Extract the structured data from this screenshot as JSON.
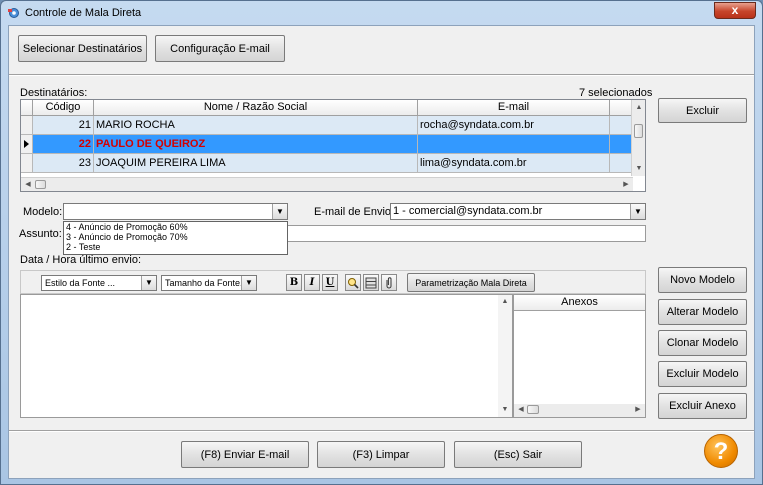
{
  "window": {
    "title": "Controle de Mala Direta",
    "close_label": "x"
  },
  "top_buttons": {
    "select_recipients": "Selecionar Destinatários",
    "email_config": "Configuração E-mail"
  },
  "recipients": {
    "label": "Destinatários:",
    "selected_count": "7 selecionados",
    "columns": [
      "Código",
      "Nome / Razão Social",
      "E-mail"
    ],
    "rows": [
      {
        "code": "21",
        "name": "MARIO ROCHA",
        "email": "rocha@syndata.com.br"
      },
      {
        "code": "22",
        "name": "PAULO DE QUEIROZ",
        "email": ""
      },
      {
        "code": "23",
        "name": "JOAQUIM PEREIRA LIMA",
        "email": "lima@syndata.com.br"
      }
    ],
    "delete_button": "Excluir"
  },
  "form": {
    "model_label": "Modelo:",
    "model_value": "",
    "model_options": [
      "4 - Anúncio de Promoção 60%",
      "3 - Anúncio de Promoção 70%",
      "2 - Teste"
    ],
    "email_from_label": "E-mail de Envio:",
    "email_from_value": "1 - comercial@syndata.com.br",
    "subject_label": "Assunto:",
    "subject_value": "",
    "last_sent_label": "Data / Hora último envio:"
  },
  "editor": {
    "font_style": "Estilo da Fonte ...",
    "font_size": "Tamanho da Fonte...",
    "bold": "B",
    "italic": "I",
    "underline": "U",
    "param_button": "Parametrização Mala Direta",
    "attachments_header": "Anexos"
  },
  "side_buttons": {
    "new_model": "Novo Modelo",
    "edit_model": "Alterar Modelo",
    "clone_model": "Clonar Modelo",
    "delete_model": "Excluir Modelo",
    "delete_attachment": "Excluir Anexo"
  },
  "bottom_buttons": {
    "send": "(F8) Enviar E-mail",
    "clear": "(F3) Limpar",
    "exit": "(Esc) Sair"
  },
  "help": {
    "label": "?"
  }
}
